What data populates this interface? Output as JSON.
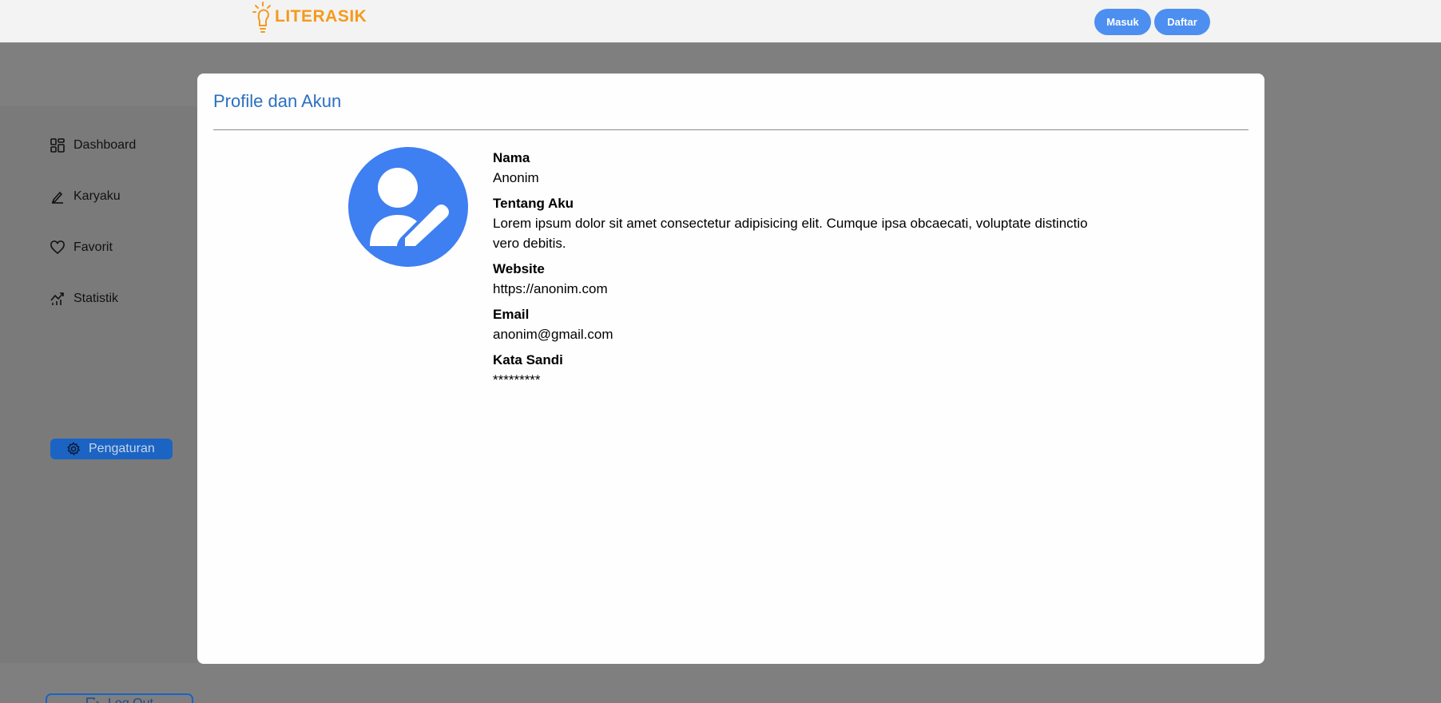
{
  "header": {
    "logo_text": "LITERASIK",
    "login_label": "Masuk",
    "register_label": "Daftar"
  },
  "sidebar": {
    "items": [
      {
        "label": "Dashboard",
        "icon": "dashboard-icon"
      },
      {
        "label": "Karyaku",
        "icon": "pen-icon"
      },
      {
        "label": "Favorit",
        "icon": "heart-icon"
      },
      {
        "label": "Statistik",
        "icon": "chart-icon"
      }
    ],
    "active_item": {
      "label": "Pengaturan",
      "icon": "gear-icon"
    },
    "logout_label": "Log Out"
  },
  "modal": {
    "title": "Profile dan Akun",
    "fields": [
      {
        "label": "Nama",
        "value": "Anonim"
      },
      {
        "label": "Tentang Aku",
        "value": "Lorem ipsum dolor sit amet consectetur adipisicing elit. Cumque ipsa obcaecati, voluptate distinctio vero debitis."
      },
      {
        "label": "Website",
        "value": "https://anonim.com"
      },
      {
        "label": "Email",
        "value": "anonim@gmail.com"
      },
      {
        "label": "Kata Sandi",
        "value": "*********"
      }
    ]
  },
  "colors": {
    "overlay": "#7f7f7f",
    "accent_blue": "#3e7ff2",
    "title_blue": "#2a6fc1",
    "logo_orange": "#f59a1b",
    "active_nav": "#1b64c4"
  }
}
